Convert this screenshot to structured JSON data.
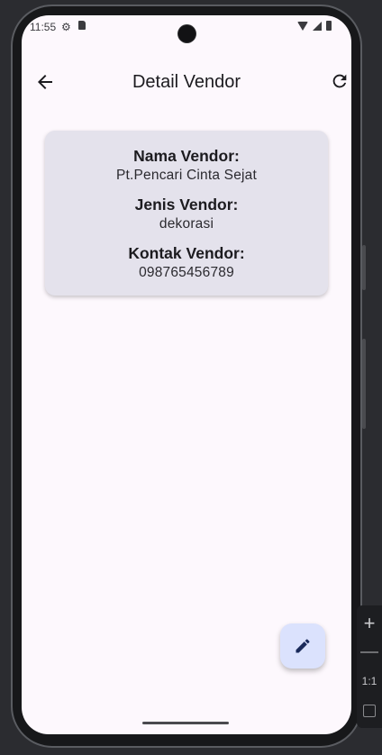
{
  "status_bar": {
    "time": "11:55",
    "icons": [
      "gear-icon",
      "sd-card-icon",
      "wifi-icon",
      "cellular-signal-icon",
      "battery-icon"
    ]
  },
  "app_bar": {
    "title": "Detail Vendor",
    "back_icon": "arrow-left-icon",
    "refresh_icon": "refresh-icon"
  },
  "vendor": {
    "name_label": "Nama Vendor:",
    "name_value": "Pt.Pencari Cinta Sejat",
    "type_label": "Jenis Vendor:",
    "type_value": "dekorasi",
    "contact_label": "Kontak Vendor:",
    "contact_value": "098765456789"
  },
  "fab": {
    "icon": "pencil-edit-icon"
  },
  "emulator_toolbar": {
    "zoom_in": "+",
    "zoom_ratio": "1:1",
    "icons": [
      "zoom-in-icon",
      "zoom-out-icon",
      "fit-screen-icon"
    ]
  },
  "colors": {
    "screen_background": "#fdf8fd",
    "card_background": "#e4e2ec",
    "fab_background": "#dbe2fd",
    "fab_icon": "#1a2a5a"
  }
}
